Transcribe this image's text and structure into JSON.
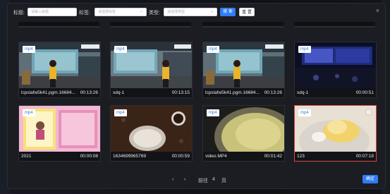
{
  "filters": {
    "title_label": "标题:",
    "title_placeholder": "请输入标题",
    "tag_label": "标签:",
    "tag_placeholder": "请选择标签",
    "type_label": "类型:",
    "type_placeholder": "请选择类型",
    "search_label": "搜 索",
    "reset_label": "重 置"
  },
  "videos": [
    {
      "name": "lcpslafw5k41.pgm.16684...",
      "duration": "00:13:26",
      "badge": "mp4",
      "selected": false
    },
    {
      "name": "sdq-1",
      "duration": "00:13:15",
      "badge": "mp4",
      "selected": false
    },
    {
      "name": "lcpslafw5k41.pgm.16684...",
      "duration": "00:13:26",
      "badge": "mp4",
      "selected": false
    },
    {
      "name": "sdq-1",
      "duration": "00:00:51",
      "badge": "mp4",
      "selected": false
    },
    {
      "name": "2021",
      "duration": "00:00:08",
      "badge": "mp4",
      "selected": false
    },
    {
      "name": "1634699965769",
      "duration": "00:00:59",
      "badge": "mp4",
      "selected": false
    },
    {
      "name": "video.MP4",
      "duration": "00:01:42",
      "badge": "mp4",
      "selected": false
    },
    {
      "name": "123",
      "duration": "00:07:18",
      "badge": "mp4",
      "selected": true
    }
  ],
  "pager": {
    "prev": "‹",
    "next": "›",
    "goto_label": "前往",
    "page_value": "4",
    "page_suffix": "页"
  },
  "confirm_label": "确定",
  "close_icon": "×"
}
